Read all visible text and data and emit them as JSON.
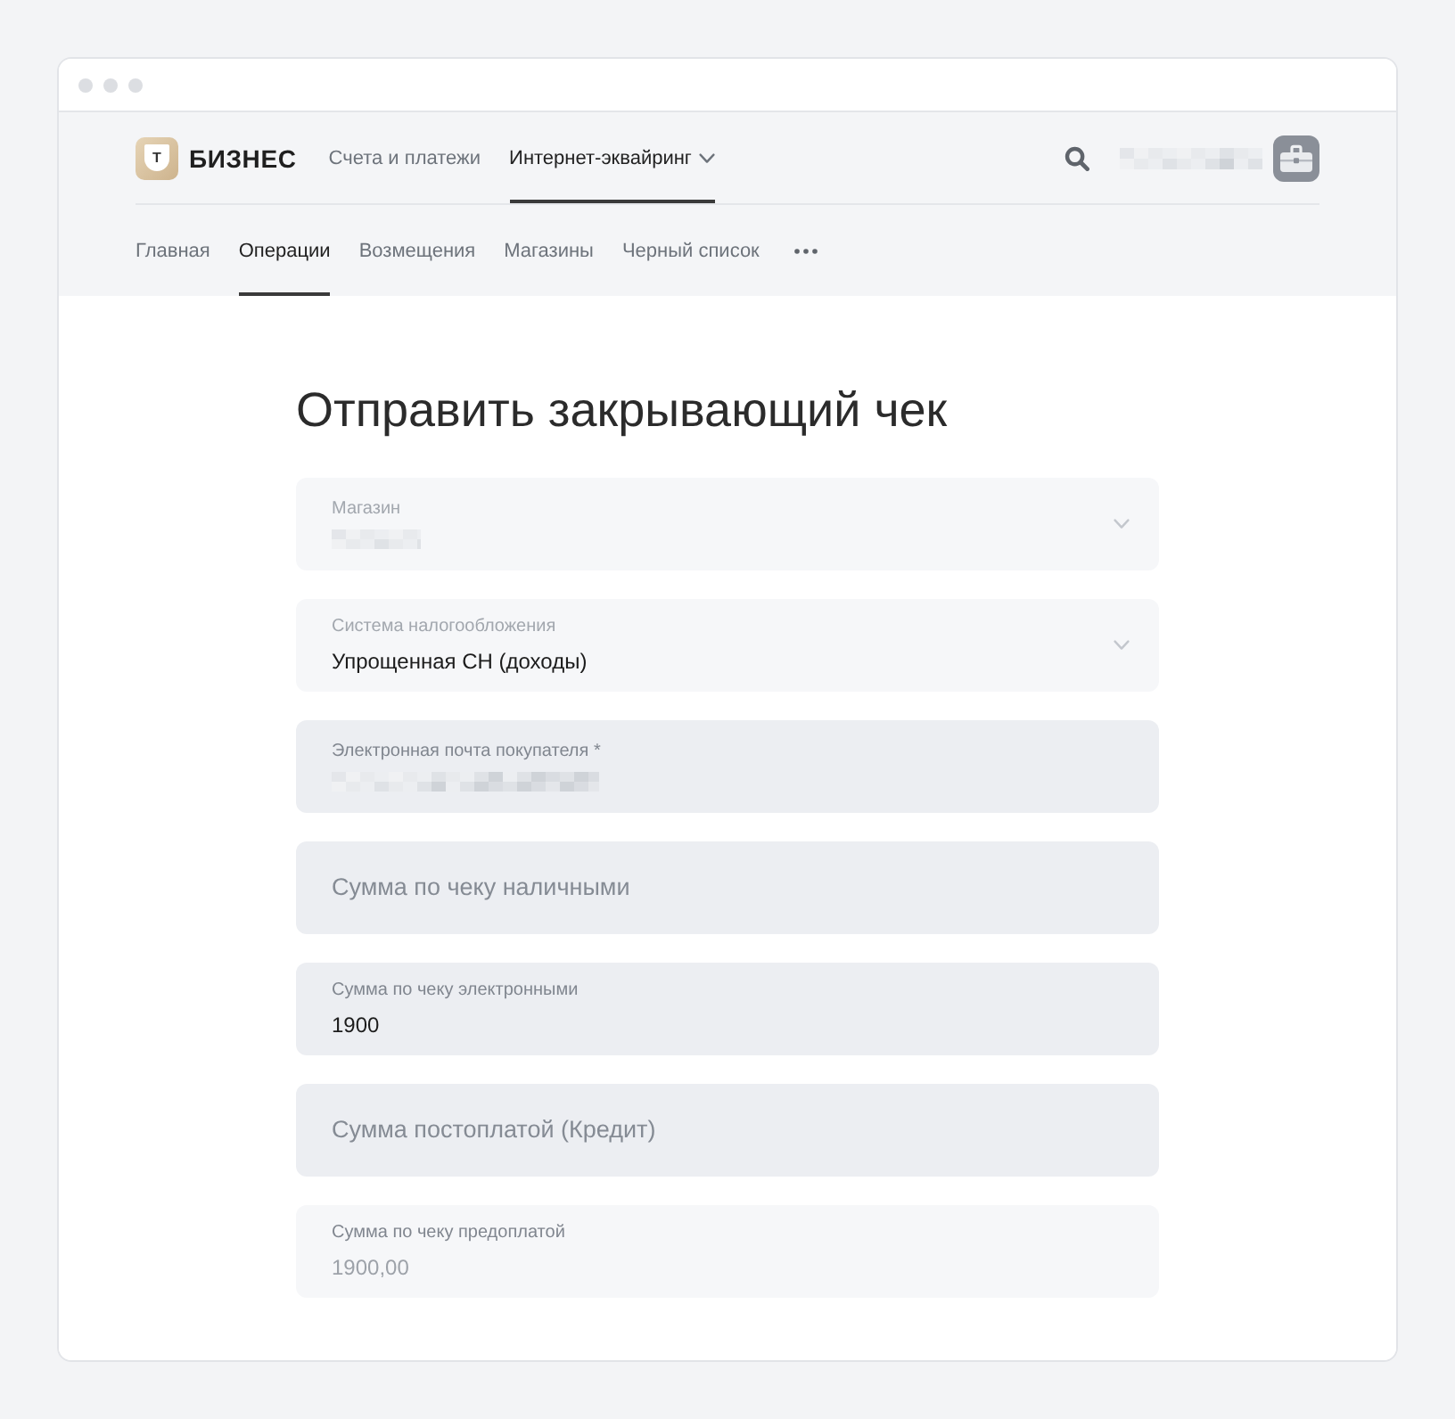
{
  "header": {
    "logo": {
      "letter": "Т",
      "name": "БИЗНЕС"
    },
    "top_nav": [
      {
        "label": "Счета и платежи",
        "selected": false,
        "dropdown": false
      },
      {
        "label": "Интернет-эквайринг",
        "selected": true,
        "dropdown": true
      }
    ],
    "account": {
      "name_hidden": true
    }
  },
  "sub_nav": {
    "items": [
      {
        "label": "Главная",
        "selected": false
      },
      {
        "label": "Операции",
        "selected": true
      },
      {
        "label": "Возмещения",
        "selected": false
      },
      {
        "label": "Магазины",
        "selected": false
      },
      {
        "label": "Черный список",
        "selected": false
      }
    ]
  },
  "form": {
    "title": "Отправить закрывающий чек",
    "fields": [
      {
        "kind": "select",
        "label": "Магазин",
        "value_hidden": true,
        "disabled": true
      },
      {
        "kind": "select",
        "label": "Система налогообложения",
        "value": "Упрощенная СН (доходы)",
        "disabled": true
      },
      {
        "kind": "input",
        "label": "Электронная почта покупателя *",
        "value_hidden": true,
        "disabled": false
      },
      {
        "kind": "input",
        "placeholder": "Сумма по чеку наличными",
        "disabled": false
      },
      {
        "kind": "input",
        "label": "Сумма по чеку электронными",
        "value": "1900",
        "disabled": false
      },
      {
        "kind": "input",
        "placeholder": "Сумма постоплатой (Кредит)",
        "disabled": false
      },
      {
        "kind": "input",
        "label": "Сумма по чеку предоплатой",
        "value": "1900,00",
        "disabled": true
      }
    ]
  }
}
